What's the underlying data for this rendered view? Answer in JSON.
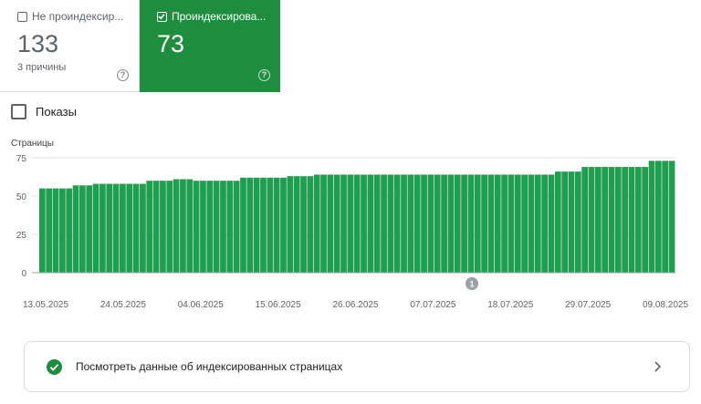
{
  "cards": {
    "not_indexed": {
      "label": "Не проиндексир...",
      "count": "133",
      "sub": "3 причины",
      "help": "?"
    },
    "indexed": {
      "label": "Проиндексирова...",
      "count": "73",
      "help": "?"
    }
  },
  "impressions_label": "Показы",
  "colors": {
    "accent": "#1e8e3e",
    "bar": "#1e9e4e"
  },
  "icons": [
    "checkbox-icon",
    "help-icon",
    "check-circle-icon",
    "chevron-right-icon"
  ],
  "chart_data": {
    "type": "bar",
    "ylabel": "Страницы",
    "ylim": [
      0,
      75
    ],
    "yticks": [
      "75",
      "50",
      "25",
      "0"
    ],
    "x_tick_labels": [
      "13.05.2025",
      "24.05.2025",
      "04.06.2025",
      "15.06.2025",
      "26.06.2025",
      "07.07.2025",
      "18.07.2025",
      "29.07.2025",
      "09.08.2025"
    ],
    "annotation": "1",
    "values": [
      55,
      55,
      55,
      55,
      55,
      57,
      57,
      57,
      58,
      58,
      58,
      58,
      58,
      58,
      58,
      58,
      60,
      60,
      60,
      60,
      61,
      61,
      61,
      60,
      60,
      60,
      60,
      60,
      60,
      60,
      62,
      62,
      62,
      62,
      62,
      62,
      62,
      63,
      63,
      63,
      63,
      64,
      64,
      64,
      64,
      64,
      64,
      64,
      64,
      64,
      64,
      64,
      64,
      64,
      64,
      64,
      64,
      64,
      64,
      64,
      64,
      64,
      64,
      64,
      64,
      64,
      64,
      64,
      64,
      64,
      64,
      64,
      64,
      64,
      64,
      64,
      64,
      66,
      66,
      66,
      66,
      69,
      69,
      69,
      69,
      69,
      69,
      69,
      69,
      69,
      69,
      73,
      73,
      73,
      73
    ]
  },
  "link_card": {
    "text": "Посмотреть данные об индексированных страницах"
  }
}
